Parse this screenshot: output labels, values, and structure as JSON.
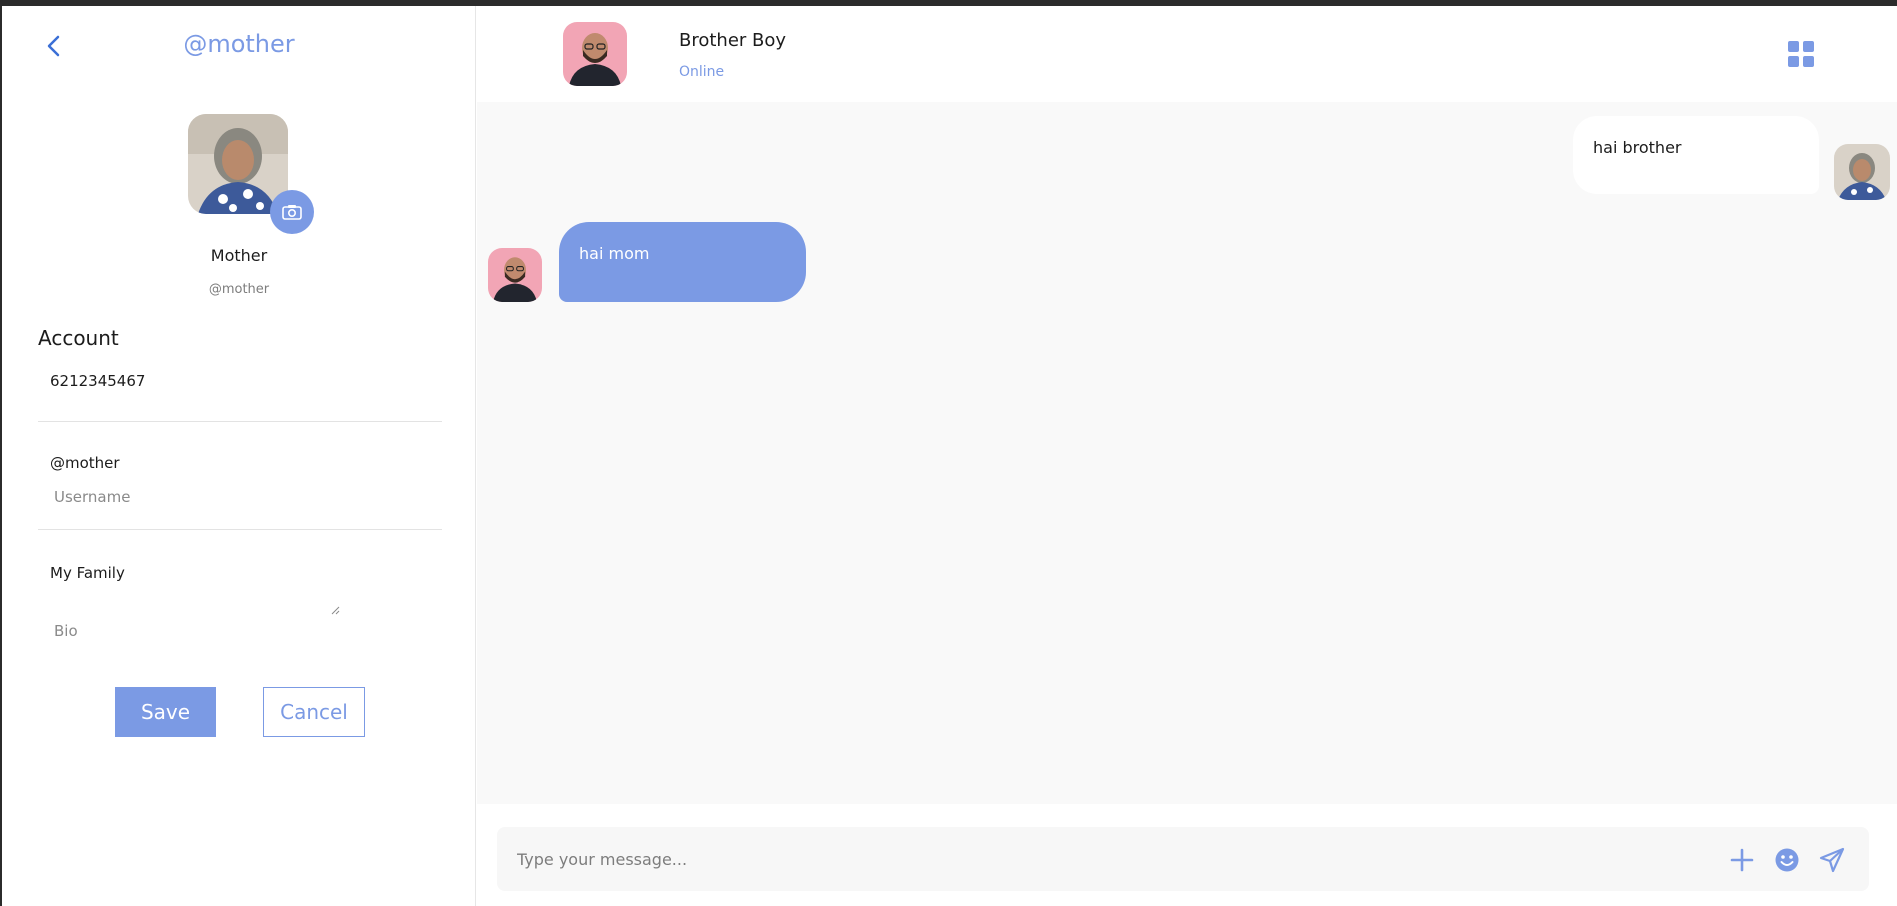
{
  "profile": {
    "title": "@mother",
    "name": "Mother",
    "handle": "@mother",
    "account_heading": "Account",
    "phone": "6212345467",
    "username_value": "@mother",
    "username_placeholder": "Username",
    "bio_value": "My Family",
    "bio_placeholder": "Bio",
    "save_label": "Save",
    "cancel_label": "Cancel"
  },
  "chat": {
    "contact_name": "Brother Boy",
    "contact_status": "Online",
    "messages": [
      {
        "direction": "outgoing",
        "text": "hai brother"
      },
      {
        "direction": "incoming",
        "text": "hai mom"
      }
    ],
    "composer_placeholder": "Type your message..."
  },
  "icons": {
    "back": "chevron-left-icon",
    "camera": "camera-icon",
    "menu": "grid-icon",
    "attach": "plus-icon",
    "emoji": "emoji-icon",
    "send": "send-icon"
  },
  "colors": {
    "accent": "#7b9ae4",
    "incoming_bubble": "#7b9ae4",
    "outgoing_bubble": "#ffffff",
    "chat_background": "#f9f9f9"
  }
}
